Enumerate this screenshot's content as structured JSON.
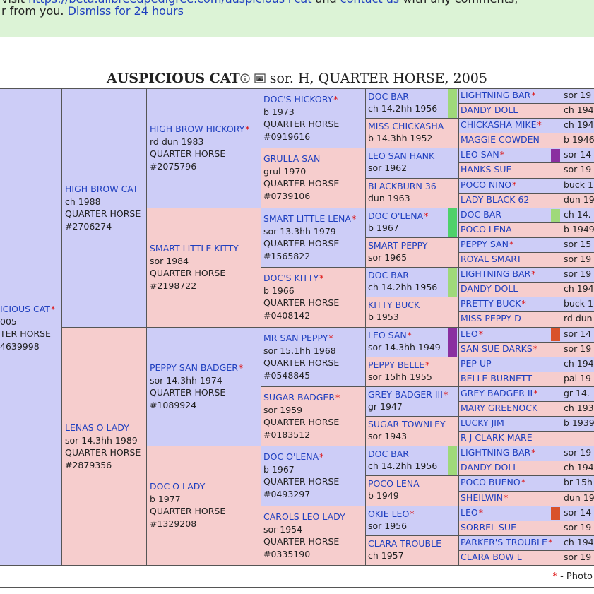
{
  "banner": {
    "line1_prefix": "visit",
    "line1_link": "https://beta.allbreedpedigree.com/auspicious+cat",
    "line1_mid": "and",
    "line1_link2": "contact us",
    "line1_suffix": "with any comments,",
    "line2_prefix": "r from you.",
    "dismiss_link": "Dismiss for 24 hours"
  },
  "title": {
    "name": "AUSPICIOUS CAT",
    "rest": "sor. H, QUARTER HORSE, 2005",
    "info_icon": "info-circle-icon",
    "photo_icon": "photo-icon"
  },
  "colors": {
    "male": "#cdcdf7",
    "female": "#f6cdcd",
    "link": "#1f3fbf",
    "star": "#d11111",
    "chip_green": "#9fd97a",
    "chip_bright": "#4fd16a",
    "chip_purple": "#8a2fa0",
    "chip_red": "#d9522b"
  },
  "pedigree": {
    "subject": {
      "name": "ICIOUS CAT",
      "star": "*",
      "lines": [
        "005",
        "TER HORSE",
        "4639998"
      ]
    },
    "gen1": [
      {
        "name": "HIGH BROW CAT",
        "star": "",
        "lines": [
          "ch 1988",
          "QUARTER HORSE",
          "#2706274"
        ]
      },
      {
        "name": "LENAS O LADY",
        "star": "",
        "lines": [
          "sor 14.3hh 1989",
          "QUARTER HORSE",
          "#2879356"
        ]
      }
    ],
    "gen2": [
      {
        "name": "HIGH BROW HICKORY",
        "star": "*",
        "lines": [
          "rd dun 1983",
          "QUARTER HORSE",
          "#2075796"
        ]
      },
      {
        "name": "SMART LITTLE KITTY",
        "star": "",
        "lines": [
          "sor 1984",
          "QUARTER HORSE",
          "#2198722"
        ]
      },
      {
        "name": "PEPPY SAN BADGER",
        "star": "*",
        "lines": [
          "sor 14.3hh 1974",
          "QUARTER HORSE",
          "#1089924"
        ]
      },
      {
        "name": "DOC O LADY",
        "star": "",
        "lines": [
          "b 1977",
          "QUARTER HORSE",
          "#1329208"
        ]
      }
    ],
    "gen3": [
      {
        "name": "DOC'S HICKORY",
        "star": "*",
        "lines": [
          "b 1973",
          "QUARTER HORSE",
          "#0919616"
        ]
      },
      {
        "name": "GRULLA SAN",
        "star": "",
        "lines": [
          "grul 1970",
          "QUARTER HORSE",
          "#0739106"
        ]
      },
      {
        "name": "SMART LITTLE LENA",
        "star": "*",
        "lines": [
          "sor 13.3hh 1979",
          "QUARTER HORSE",
          "#1565822"
        ]
      },
      {
        "name": "DOC'S KITTY",
        "star": "*",
        "lines": [
          "b 1966",
          "QUARTER HORSE",
          "#0408142"
        ]
      },
      {
        "name": "MR SAN PEPPY",
        "star": "*",
        "lines": [
          "sor 15.1hh 1968",
          "QUARTER HORSE",
          "#0548845"
        ]
      },
      {
        "name": "SUGAR BADGER",
        "star": "*",
        "lines": [
          "sor 1959",
          "QUARTER HORSE",
          "#0183512"
        ]
      },
      {
        "name": "DOC O'LENA",
        "star": "*",
        "lines": [
          "b 1967",
          "QUARTER HORSE",
          "#0493297"
        ]
      },
      {
        "name": "CAROLS LEO LADY",
        "star": "",
        "lines": [
          "sor 1954",
          "QUARTER HORSE",
          "#0335190"
        ]
      }
    ],
    "gen4": [
      {
        "name": "DOC BAR",
        "star": "",
        "detail": "ch 14.2hh 1956",
        "chip": "#9fd97a"
      },
      {
        "name": "MISS CHICKASHA",
        "star": "",
        "detail": "b 14.3hh 1952",
        "chip": ""
      },
      {
        "name": "LEO SAN HANK",
        "star": "",
        "detail": "sor 1962",
        "chip": ""
      },
      {
        "name": "BLACKBURN 36",
        "star": "",
        "detail": "dun 1963",
        "chip": ""
      },
      {
        "name": "DOC O'LENA",
        "star": "*",
        "detail": "b 1967",
        "chip": "#4fd16a"
      },
      {
        "name": "SMART PEPPY",
        "star": "",
        "detail": "sor 1965",
        "chip": ""
      },
      {
        "name": "DOC BAR",
        "star": "",
        "detail": "ch 14.2hh 1956",
        "chip": "#9fd97a"
      },
      {
        "name": "KITTY BUCK",
        "star": "",
        "detail": "b 1953",
        "chip": ""
      },
      {
        "name": "LEO SAN",
        "star": "*",
        "detail": "sor 14.3hh 1949",
        "chip": "#8a2fa0"
      },
      {
        "name": "PEPPY BELLE",
        "star": "*",
        "detail": "sor 15hh 1955",
        "chip": ""
      },
      {
        "name": "GREY BADGER III",
        "star": "*",
        "detail": "gr 1947",
        "chip": ""
      },
      {
        "name": "SUGAR TOWNLEY",
        "star": "",
        "detail": "sor 1943",
        "chip": ""
      },
      {
        "name": "DOC BAR",
        "star": "",
        "detail": "ch 14.2hh 1956",
        "chip": "#9fd97a"
      },
      {
        "name": "POCO LENA",
        "star": "",
        "detail": "b 1949",
        "chip": ""
      },
      {
        "name": "OKIE LEO",
        "star": "*",
        "detail": "sor 1956",
        "chip": ""
      },
      {
        "name": "CLARA TROUBLE",
        "star": "",
        "detail": "ch 1957",
        "chip": ""
      }
    ],
    "gen5": [
      {
        "name": "LIGHTNING BAR",
        "star": "*",
        "chip": ""
      },
      {
        "name": "DANDY DOLL",
        "star": "",
        "chip": ""
      },
      {
        "name": "CHICKASHA MIKE",
        "star": "*",
        "chip": ""
      },
      {
        "name": "MAGGIE COWDEN",
        "star": "",
        "chip": ""
      },
      {
        "name": "LEO SAN",
        "star": "*",
        "chip": "#8a2fa0"
      },
      {
        "name": "HANKS SUE",
        "star": "",
        "chip": ""
      },
      {
        "name": "POCO NINO",
        "star": "*",
        "chip": ""
      },
      {
        "name": "LADY BLACK 62",
        "star": "",
        "chip": ""
      },
      {
        "name": "DOC BAR",
        "star": "",
        "chip": "#9fd97a"
      },
      {
        "name": "POCO LENA",
        "star": "",
        "chip": ""
      },
      {
        "name": "PEPPY SAN",
        "star": "*",
        "chip": ""
      },
      {
        "name": "ROYAL SMART",
        "star": "",
        "chip": ""
      },
      {
        "name": "LIGHTNING BAR",
        "star": "*",
        "chip": ""
      },
      {
        "name": "DANDY DOLL",
        "star": "",
        "chip": ""
      },
      {
        "name": "PRETTY BUCK",
        "star": "*",
        "chip": ""
      },
      {
        "name": "MISS PEPPY D",
        "star": "",
        "chip": ""
      },
      {
        "name": "LEO",
        "star": "*",
        "chip": "#d9522b"
      },
      {
        "name": "SAN SUE DARKS",
        "star": "*",
        "chip": ""
      },
      {
        "name": "PEP UP",
        "star": "",
        "chip": ""
      },
      {
        "name": "BELLE BURNETT",
        "star": "",
        "chip": ""
      },
      {
        "name": "GREY BADGER II",
        "star": "*",
        "chip": ""
      },
      {
        "name": "MARY GREENOCK",
        "star": "",
        "chip": ""
      },
      {
        "name": "LUCKY JIM",
        "star": "",
        "chip": ""
      },
      {
        "name": "R J CLARK MARE",
        "star": "",
        "chip": ""
      },
      {
        "name": "LIGHTNING BAR",
        "star": "*",
        "chip": ""
      },
      {
        "name": "DANDY DOLL",
        "star": "",
        "chip": ""
      },
      {
        "name": "POCO BUENO",
        "star": "*",
        "chip": ""
      },
      {
        "name": "SHEILWIN",
        "star": "*",
        "chip": ""
      },
      {
        "name": "LEO",
        "star": "*",
        "chip": "#d9522b"
      },
      {
        "name": "SORREL SUE",
        "star": "",
        "chip": ""
      },
      {
        "name": "PARKER'S TROUBLE",
        "star": "*",
        "chip": ""
      },
      {
        "name": "CLARA BOW L",
        "star": "",
        "chip": ""
      }
    ],
    "gen6": [
      "sor 19",
      "ch 194",
      "ch 194",
      "b 1946",
      "sor 14",
      "sor 19",
      "buck 1",
      "dun 19",
      "ch 14.",
      "b 1949",
      "sor 15",
      "sor 19",
      "sor 19",
      "ch 194",
      "buck 1",
      "rd dun",
      "sor 14",
      "sor 19",
      "ch 194",
      "pal 19",
      "gr 14.",
      "ch 193",
      "b 1939",
      "",
      "sor 19",
      "ch 194",
      "br 15h",
      "dun 19",
      "sor 14",
      "sor 19",
      "ch 194",
      "sor 19"
    ]
  },
  "footer": {
    "star": "*",
    "legend": "- Photo"
  }
}
